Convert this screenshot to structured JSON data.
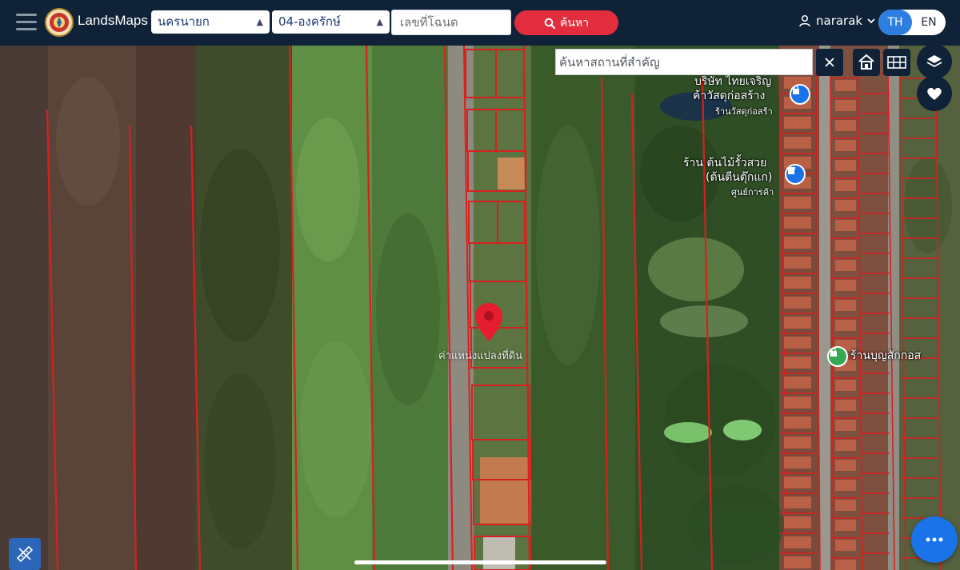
{
  "app": {
    "brand": "LandsMaps"
  },
  "header": {
    "province": {
      "selected": "นครนายก"
    },
    "district": {
      "selected": "04-องครักษ์"
    },
    "deed_input": {
      "placeholder": "เลขที่โฉนด",
      "value": ""
    },
    "search_button": {
      "label": "ค้นหา"
    },
    "user": {
      "name": "nararak"
    },
    "language": {
      "options": [
        "TH",
        "EN"
      ],
      "active": "TH"
    }
  },
  "map": {
    "place_search": {
      "placeholder": "ค้นหาสถานที่สำคัญ",
      "value": ""
    },
    "labels": {
      "company_line1": "บริษัท ไทยเจริญ",
      "company_line2": "ค้าวัสดุก่อสร้าง",
      "company_line3": "ร้านวัสดุก่อสร้า",
      "plant_shop_line1": "ร้าน ต้นไม้รั้วสวย",
      "plant_shop_line2": "(ต้นตีนตุ๊กแก)",
      "plant_shop_line3": "ศูนย์การค้า",
      "market_shop": "ร้านบุญสักกอส",
      "parcel_text": "ค่าแหน่งแปลงที่ดิน"
    },
    "icons": {
      "poi_shop": "shopping-bag-icon",
      "poi_store": "store-icon",
      "poi_market": "market-icon",
      "marker": "location-pin-icon"
    },
    "colors": {
      "parcel_line": "#d91f1f",
      "marker": "#e51d2e",
      "poi_blue": "#1a73e8",
      "poi_green": "#34a853",
      "topbar": "#0f2237",
      "accent_red": "#e12d3d",
      "accent_blue": "#2d7ee0"
    }
  }
}
